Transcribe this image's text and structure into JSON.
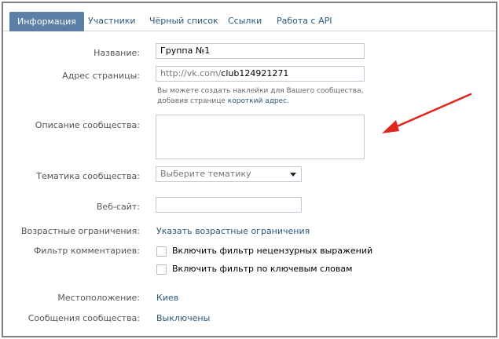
{
  "tabs": [
    {
      "label": "Информация",
      "active": true
    },
    {
      "label": "Участники"
    },
    {
      "label": "Чёрный список"
    },
    {
      "label": "Ссылки"
    },
    {
      "label": "Работа с API"
    }
  ],
  "form": {
    "name_label": "Название:",
    "name_value": "Группа №1",
    "address_label": "Адрес страницы:",
    "address_prefix": "http://vk.com/",
    "address_value": "club124921271",
    "hint_line1": "Вы можете создать наклейки для Вашего сообщества,",
    "hint_line2_text": "добавив странице ",
    "hint_link": "короткий адрес",
    "hint_end": ".",
    "description_label": "Описание сообщества:",
    "topic_label": "Тематика сообщества:",
    "topic_placeholder": "Выберите тематику",
    "website_label": "Веб-сайт:",
    "age_label": "Возрастные ограничения:",
    "age_link": "Указать возрастные ограничения",
    "filter_label": "Фильтр комментариев:",
    "filter_option1": "Включить фильтр нецензурных выражений",
    "filter_option2": "Включить фильтр по ключевым словам",
    "location_label": "Местоположение:",
    "location_value": "Киев",
    "messages_label": "Сообщения сообщества:",
    "messages_value": "Выключены"
  },
  "colors": {
    "accent": "#5b7fa6",
    "link": "#2b587a",
    "arrow": "#e0261e"
  }
}
